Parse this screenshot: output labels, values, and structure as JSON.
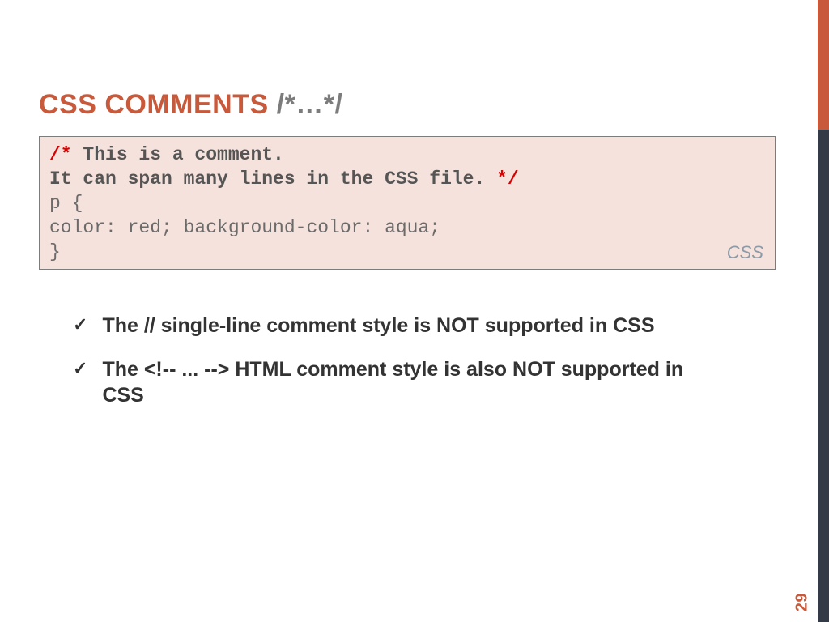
{
  "title": {
    "main": "CSS COMMENTS ",
    "suffix": "/*…*/"
  },
  "code": {
    "open_delim": "/*",
    "comment_line1": " This is a comment.",
    "comment_line2": "It can span many lines in the CSS file. ",
    "close_delim": "*/",
    "line3": "p {",
    "line4": "color: red; background-color: aqua;",
    "line5": "}",
    "label": "CSS"
  },
  "bullets": [
    "The // single-line comment style is NOT supported in CSS",
    "The <!-- ... --> HTML comment style is also NOT supported in CSS"
  ],
  "checkmark": "✓",
  "page_number": "29"
}
